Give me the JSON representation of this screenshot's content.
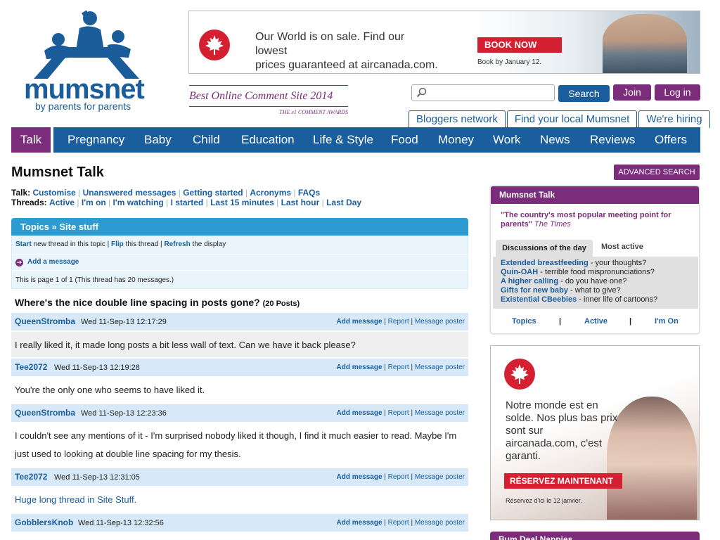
{
  "header": {
    "logo": {
      "word": "mumsnet",
      "tagline": "by parents for parents"
    },
    "award": {
      "title": "Best Online Comment Site 2014",
      "subtitle": "THE e1 COMMENT AWARDS"
    },
    "search": {
      "placeholder": "",
      "button": "Search"
    },
    "join": "Join",
    "login": "Log in",
    "subtabs": [
      "Bloggers network",
      "Find your local Mumsnet",
      "We're hiring"
    ]
  },
  "ad_top": {
    "line1": "Our World is on sale. Find our lowest",
    "line2": "prices guaranteed at aircanada.com.",
    "cta": "BOOK NOW",
    "note": "Book by January 12."
  },
  "nav": {
    "talk": "Talk",
    "items": [
      "Pregnancy",
      "Baby",
      "Child",
      "Education",
      "Life & Style",
      "Food",
      "Money",
      "Work",
      "News",
      "Reviews",
      "Offers"
    ]
  },
  "page": {
    "title": "Mumsnet Talk",
    "talk_label": "Talk:",
    "talk_links": [
      "Customise",
      "Unanswered messages",
      "Getting started",
      "Acronyms",
      "FAQs"
    ],
    "threads_label": "Threads:",
    "thread_links": [
      "Active",
      "I'm on",
      "I'm watching",
      "I started",
      "Last 15 minutes",
      "Last hour",
      "Last Day"
    ]
  },
  "topic": {
    "breadcrumb": "Topics » Site stuff",
    "start": "Start",
    "start_text": "new thread in this topic |",
    "flip": "Flip",
    "flip_text": "this thread |",
    "refresh": "Refresh",
    "refresh_text": "the display",
    "add_message": "Add a message",
    "page_info": "This is page 1 of 1 (This thread has 20 messages.)"
  },
  "thread": {
    "title": "Where's the nice double line spacing in posts gone?",
    "count": "(20 Posts)",
    "action_add": "Add message",
    "action_report": "Report",
    "action_poster": "Message poster",
    "posts": [
      {
        "name": "QueenStromba",
        "date": "Wed 11-Sep-13 12:17:29",
        "body": "I really liked it, it made long posts a bit less wall of text. Can we have it back please?"
      },
      {
        "name": "Tee2072",
        "date": "Wed 11-Sep-13 12:19:28",
        "body": "You're the only one who seems to have liked it."
      },
      {
        "name": "QueenStromba",
        "date": "Wed 11-Sep-13 12:23:36",
        "body": "I couldn't see any mentions of it - I'm surprised nobody liked it though, I find it much easier to read. Maybe I'm just used to looking at double line spacing for my thesis."
      },
      {
        "name": "Tee2072",
        "date": "Wed 11-Sep-13 12:31:05",
        "body": "Huge long thread in Site Stuff."
      },
      {
        "name": "GobblersKnob",
        "date": "Wed 11-Sep-13 12:32:56",
        "body": ""
      }
    ]
  },
  "sidebar": {
    "advanced_search": "ADVANCED SEARCH",
    "box_title": "Mumsnet Talk",
    "quote": "\"The country's most popular meeting point for parents\"",
    "quote_source": "The Times",
    "tab_active": "Discussions of the day",
    "tab_inactive": "Most active",
    "discussions": [
      {
        "link": "Extended breastfeeding",
        "text": " - your thoughts?"
      },
      {
        "link": "Quin-OAH",
        "text": " - terrible food mispronunciations?"
      },
      {
        "link": "A higher calling",
        "text": " - do you have one?"
      },
      {
        "link": "Gifts for new baby",
        "text": " - what to give?"
      },
      {
        "link": "Existential CBeebies",
        "text": " - inner life of cartoons?"
      }
    ],
    "footer_links": [
      "Topics",
      "|",
      "Active",
      "|",
      "I'm On"
    ],
    "bottom_box_title": "Bum Deal Nappies"
  },
  "ad_side": {
    "text": "Notre monde est en solde. Nos plus bas prix sont sur aircanada.com, c'est garanti.",
    "cta": "RÉSERVEZ MAINTENANT",
    "note": "Réservez d'ici le 12 janvier."
  },
  "colors": {
    "brand_blue": "#1a5e9e",
    "brand_purple": "#7b2d7b",
    "topic_bar": "#2b9bd0",
    "post_header": "#d7e9f8",
    "aircanada_red": "#d42030"
  }
}
